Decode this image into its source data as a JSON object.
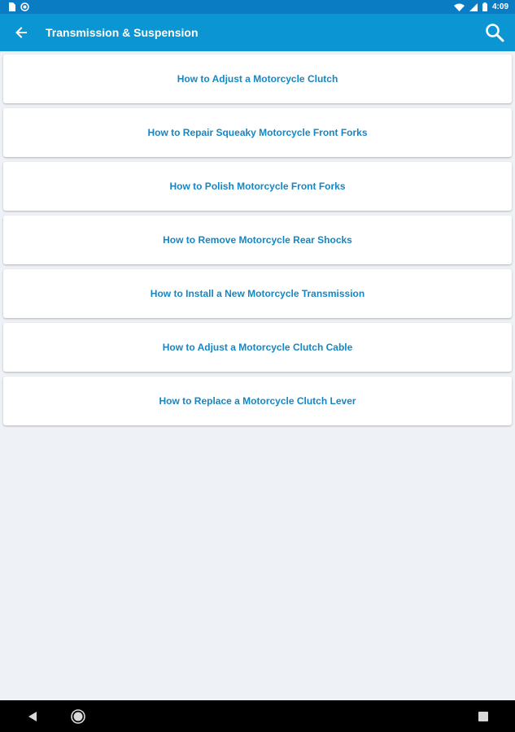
{
  "status_bar": {
    "time": "4:09",
    "left_icons": [
      "sim-card-icon",
      "notification-dot-icon"
    ],
    "right_icons": [
      "wifi-icon",
      "signal-icon",
      "battery-icon"
    ]
  },
  "app_bar": {
    "title": "Transmission & Suspension",
    "back_icon": "arrow-left-icon",
    "search_icon": "search-icon",
    "background_color": "#0b96d3",
    "status_color": "#0a7cc4"
  },
  "articles": [
    {
      "label": "How to Adjust a Motorcycle Clutch"
    },
    {
      "label": "How to Repair Squeaky Motorcycle Front Forks"
    },
    {
      "label": "How to Polish Motorcycle Front Forks"
    },
    {
      "label": "How to Remove Motorcycle Rear Shocks"
    },
    {
      "label": "How to Install a New Motorcycle Transmission"
    },
    {
      "label": "How to Adjust a Motorcycle Clutch Cable"
    },
    {
      "label": "How to Replace a Motorcycle Clutch Lever"
    }
  ],
  "accent_color": "#1487c4",
  "nav_bar": {
    "icons": [
      "nav-back-icon",
      "nav-home-icon",
      "nav-recents-icon"
    ]
  }
}
